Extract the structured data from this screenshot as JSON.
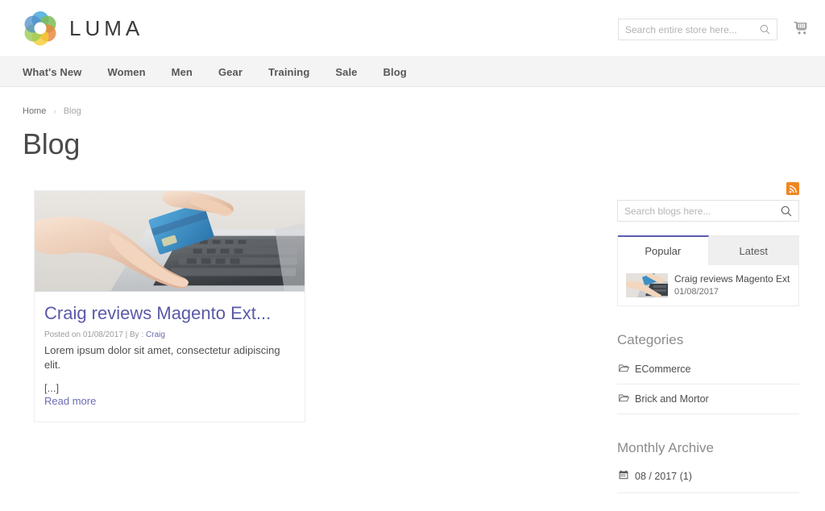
{
  "header": {
    "logo_text": "LUMA",
    "logo_icon": "luma-flower-logo",
    "search_placeholder": "Search entire store here...",
    "search_value": "",
    "search_icon": "search-icon",
    "cart_icon": "shopping-cart-icon"
  },
  "nav": {
    "items": [
      {
        "label": "What's New"
      },
      {
        "label": "Women"
      },
      {
        "label": "Men"
      },
      {
        "label": "Gear"
      },
      {
        "label": "Training"
      },
      {
        "label": "Sale"
      },
      {
        "label": "Blog"
      }
    ]
  },
  "breadcrumb": {
    "home": "Home",
    "separator": "›",
    "current": "Blog"
  },
  "page": {
    "title": "Blog"
  },
  "post": {
    "image_alt": "hands typing on laptop keyboard holding credit card",
    "title": "Craig reviews Magento Ext...",
    "meta_prefix": "Posted on 01/08/2017 | By :",
    "author": "Craig",
    "excerpt": "Lorem ipsum dolor sit amet, consectetur adipiscing elit.",
    "ellipsis": "[...]",
    "read_more": "Read more"
  },
  "sidebar": {
    "rss_icon": "rss-feed-icon",
    "search_placeholder": "Search blogs here...",
    "search_value": "",
    "search_icon": "search-icon",
    "tabs": [
      {
        "label": "Popular",
        "active": true
      },
      {
        "label": "Latest",
        "active": false
      }
    ],
    "popular_posts": [
      {
        "title": "Craig reviews Magento Exte...",
        "date": "01/08/2017",
        "thumb_alt": "hands typing on laptop keyboard"
      }
    ],
    "categories_heading": "Categories",
    "categories": [
      {
        "label": "ECommerce",
        "icon": "folder-icon"
      },
      {
        "label": "Brick and Mortor",
        "icon": "folder-icon"
      }
    ],
    "archive_heading": "Monthly Archive",
    "archive": [
      {
        "label": "08 / 2017 (1)",
        "icon": "calendar-icon"
      }
    ]
  },
  "colors": {
    "accent_purple": "#5c5cb0",
    "link_purple": "#6b6bb5",
    "rss_orange": "#f08521",
    "nav_bg": "#f4f4f4",
    "text_dark": "#333333"
  }
}
